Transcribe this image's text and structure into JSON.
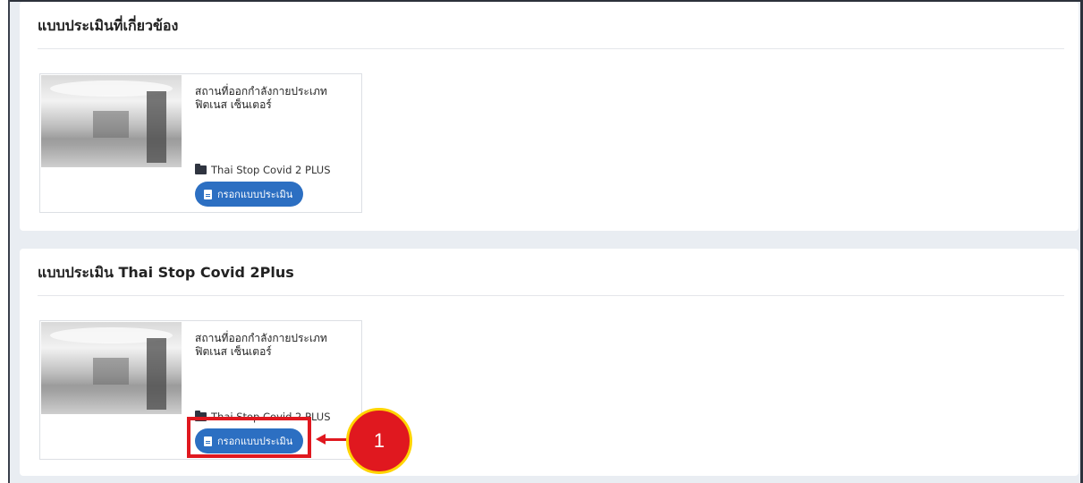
{
  "sections": [
    {
      "title": "แบบประเมินที่เกี่ยวข้อง",
      "card": {
        "title": "สถานที่ออกกำลังกายประเภทฟิตเนส เซ็นเตอร์",
        "category": "Thai Stop Covid 2 PLUS",
        "button_label": "กรอกแบบประเมิน"
      }
    },
    {
      "title": "แบบประเมิน Thai Stop Covid 2Plus",
      "card": {
        "title": "สถานที่ออกกำลังกายประเภทฟิตเนส เซ็นเตอร์",
        "category": "Thai Stop Covid 2 PLUS",
        "button_label": "กรอกแบบประเมิน"
      }
    }
  ],
  "annotation": {
    "step_number": "1",
    "color": "#e0181f",
    "border_color": "#ffd400"
  },
  "icons": {
    "category": "folder-open-icon",
    "button": "file-text-icon"
  },
  "colors": {
    "button": "#2c6fc2",
    "background": "#e9edf2"
  }
}
